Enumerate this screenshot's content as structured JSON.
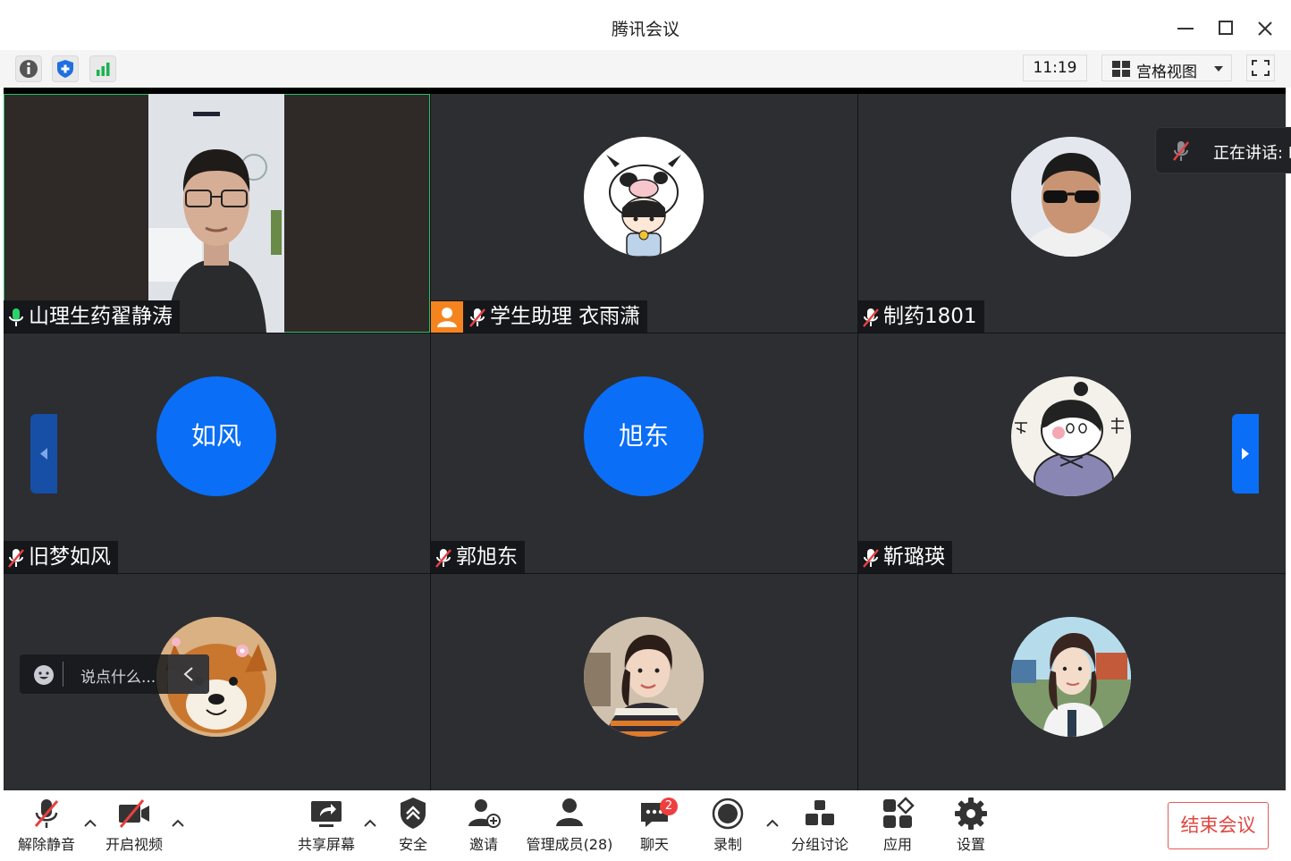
{
  "window": {
    "title": "腾讯会议"
  },
  "toolbar": {
    "time": "11:19",
    "view_label": "宫格视图"
  },
  "participants": [
    {
      "name": "山理生药翟静涛",
      "kind": "video",
      "mic": "on"
    },
    {
      "name": "学生助理 衣雨潇",
      "kind": "image",
      "image": "cartoon-cow-girl",
      "mic": "muted",
      "host_badge": true
    },
    {
      "name": "制药1801",
      "kind": "image",
      "image": "man-in-sunglasses",
      "mic": "muted"
    },
    {
      "name": "旧梦如风",
      "kind": "text",
      "avatar_text": "如风",
      "mic": "muted"
    },
    {
      "name": "郭旭东",
      "kind": "text",
      "avatar_text": "旭东",
      "mic": "muted"
    },
    {
      "name": "靳璐瑛",
      "kind": "image",
      "image": "cartoon-bu-guan",
      "mic": "muted"
    },
    {
      "name": "",
      "kind": "image",
      "image": "shiba-dog",
      "mic": "muted"
    },
    {
      "name": "",
      "kind": "image",
      "image": "girl-photo",
      "mic": "muted"
    },
    {
      "name": "",
      "kind": "image",
      "image": "woman-photo",
      "mic": "muted"
    }
  ],
  "speaking": {
    "label": "正在讲话: L"
  },
  "chat": {
    "placeholder": "说点什么..."
  },
  "bottom": {
    "unmute": "解除静音",
    "start_video": "开启视频",
    "share_screen": "共享屏幕",
    "security": "安全",
    "invite": "邀请",
    "manage_members": "管理成员(28)",
    "chat": "聊天",
    "chat_badge": "2",
    "record": "录制",
    "breakout": "分组讨论",
    "apps": "应用",
    "settings": "设置",
    "end_meeting": "结束会议"
  },
  "colors": {
    "accent": "#0a6ef7",
    "end_red": "#e0463f",
    "tile_bg": "#2c2e32",
    "badge_red": "#ee3f3f"
  }
}
